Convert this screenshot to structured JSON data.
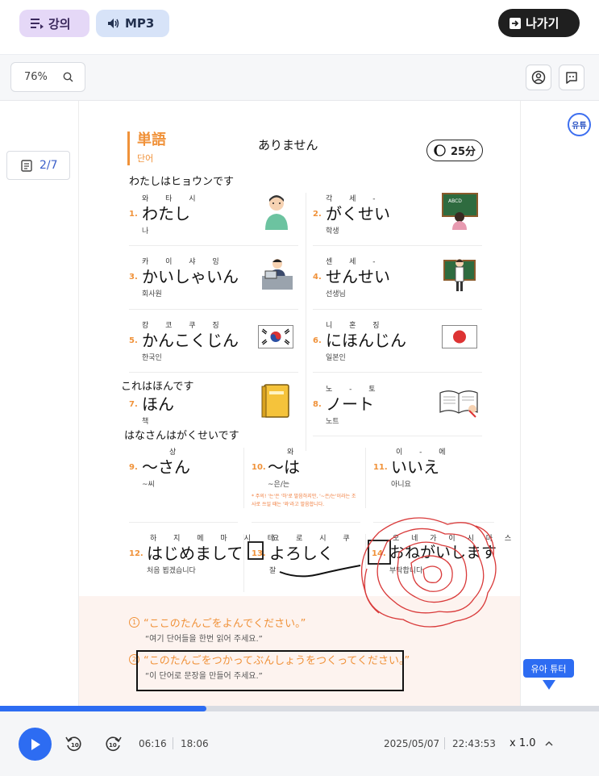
{
  "header": {
    "lecture_label": "강의",
    "mp3_label": "MP3",
    "exit_label": "나가기"
  },
  "toolbar": {
    "zoom": "76%",
    "page_indicator": "2/7"
  },
  "side": {
    "yuryu_badge": "유튜",
    "tutor_label": "유아 튜터"
  },
  "doc": {
    "section_title": "単語",
    "section_sub": "단어",
    "time_label": "25分",
    "handwritten": {
      "top": "ありません",
      "line1": "わたしはヒョウンです",
      "line2": "これはほんです",
      "line3": "はなさんはがくせいです"
    },
    "vocab": [
      {
        "num": "1.",
        "ruby": "와 타 시",
        "word": "わたし",
        "meaning": "나"
      },
      {
        "num": "2.",
        "ruby": "각 세 -",
        "word": "がくせい",
        "meaning": "학생"
      },
      {
        "num": "3.",
        "ruby": "카 이 샤 잉",
        "word": "かいしゃいん",
        "meaning": "회사원"
      },
      {
        "num": "4.",
        "ruby": "센 세 -",
        "word": "せんせい",
        "meaning": "선생님"
      },
      {
        "num": "5.",
        "ruby": "캉 코 쿠 징",
        "word": "かんこくじん",
        "meaning": "한국인"
      },
      {
        "num": "6.",
        "ruby": "니 혼 징",
        "word": "にほんじん",
        "meaning": "일본인"
      },
      {
        "num": "7.",
        "ruby": "",
        "word": "ほん",
        "meaning": "책"
      },
      {
        "num": "8.",
        "ruby": "노 - 토",
        "word": "ノート",
        "meaning": "노트"
      },
      {
        "num": "9.",
        "ruby": "상",
        "word": "～さん",
        "meaning": "~씨"
      },
      {
        "num": "10.",
        "ruby": "와",
        "word": "～は",
        "meaning": "~은/는"
      },
      {
        "num": "11.",
        "ruby": "이 - 에",
        "word": "いいえ",
        "meaning": "아니요"
      },
      {
        "num": "12.",
        "ruby": "하 지 메 마 시 테",
        "word": "はじめまして",
        "meaning": "처음 뵙겠습니다"
      },
      {
        "num": "13.",
        "ruby": "요 로 시 쿠",
        "word": "よろしく",
        "meaning": "잘"
      },
      {
        "num": "14.",
        "ruby": "오 네 가 이 시 마 스",
        "word": "おねがいします",
        "meaning": "부탁합니다"
      }
    ],
    "note": "* 주의! '는'은 '하'로 발음하지만, '~은/는'이라는 조사로 쓰일 때는 '와'라고 발음합니다.",
    "instructions": [
      {
        "num": "1",
        "jp": "“ここのたんごをよんでください。”",
        "ko": "“여기 단어들을 한번 읽어 주세요.”"
      },
      {
        "num": "2",
        "jp": "“このたんごをつかってぶんしょうをつくってください。”",
        "ko": "“이 단어로 문장을 만들어 주세요.”"
      }
    ]
  },
  "player": {
    "current_time": "06:16",
    "total_time": "18:06",
    "date": "2025/05/07",
    "clock": "22:43:53",
    "speed": "x 1.0",
    "progress": 0.345
  },
  "colors": {
    "accent": "#2d6cf2",
    "orange": "#f0923a",
    "annotation_red": "#d93a3a"
  }
}
